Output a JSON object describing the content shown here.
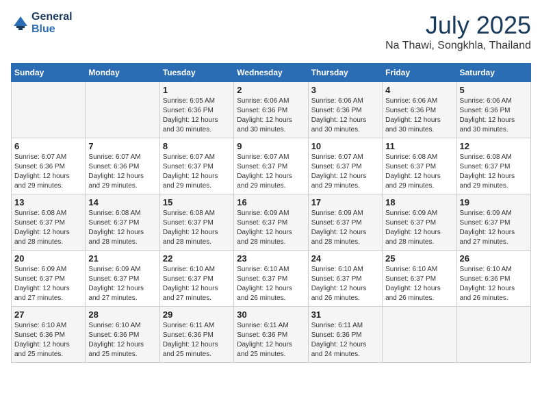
{
  "header": {
    "logo_line1": "General",
    "logo_line2": "Blue",
    "month_year": "July 2025",
    "location": "Na Thawi, Songkhla, Thailand"
  },
  "weekdays": [
    "Sunday",
    "Monday",
    "Tuesday",
    "Wednesday",
    "Thursday",
    "Friday",
    "Saturday"
  ],
  "weeks": [
    [
      {
        "day": "",
        "info": ""
      },
      {
        "day": "",
        "info": ""
      },
      {
        "day": "1",
        "info": "Sunrise: 6:05 AM\nSunset: 6:36 PM\nDaylight: 12 hours and 30 minutes."
      },
      {
        "day": "2",
        "info": "Sunrise: 6:06 AM\nSunset: 6:36 PM\nDaylight: 12 hours and 30 minutes."
      },
      {
        "day": "3",
        "info": "Sunrise: 6:06 AM\nSunset: 6:36 PM\nDaylight: 12 hours and 30 minutes."
      },
      {
        "day": "4",
        "info": "Sunrise: 6:06 AM\nSunset: 6:36 PM\nDaylight: 12 hours and 30 minutes."
      },
      {
        "day": "5",
        "info": "Sunrise: 6:06 AM\nSunset: 6:36 PM\nDaylight: 12 hours and 30 minutes."
      }
    ],
    [
      {
        "day": "6",
        "info": "Sunrise: 6:07 AM\nSunset: 6:36 PM\nDaylight: 12 hours and 29 minutes."
      },
      {
        "day": "7",
        "info": "Sunrise: 6:07 AM\nSunset: 6:36 PM\nDaylight: 12 hours and 29 minutes."
      },
      {
        "day": "8",
        "info": "Sunrise: 6:07 AM\nSunset: 6:37 PM\nDaylight: 12 hours and 29 minutes."
      },
      {
        "day": "9",
        "info": "Sunrise: 6:07 AM\nSunset: 6:37 PM\nDaylight: 12 hours and 29 minutes."
      },
      {
        "day": "10",
        "info": "Sunrise: 6:07 AM\nSunset: 6:37 PM\nDaylight: 12 hours and 29 minutes."
      },
      {
        "day": "11",
        "info": "Sunrise: 6:08 AM\nSunset: 6:37 PM\nDaylight: 12 hours and 29 minutes."
      },
      {
        "day": "12",
        "info": "Sunrise: 6:08 AM\nSunset: 6:37 PM\nDaylight: 12 hours and 29 minutes."
      }
    ],
    [
      {
        "day": "13",
        "info": "Sunrise: 6:08 AM\nSunset: 6:37 PM\nDaylight: 12 hours and 28 minutes."
      },
      {
        "day": "14",
        "info": "Sunrise: 6:08 AM\nSunset: 6:37 PM\nDaylight: 12 hours and 28 minutes."
      },
      {
        "day": "15",
        "info": "Sunrise: 6:08 AM\nSunset: 6:37 PM\nDaylight: 12 hours and 28 minutes."
      },
      {
        "day": "16",
        "info": "Sunrise: 6:09 AM\nSunset: 6:37 PM\nDaylight: 12 hours and 28 minutes."
      },
      {
        "day": "17",
        "info": "Sunrise: 6:09 AM\nSunset: 6:37 PM\nDaylight: 12 hours and 28 minutes."
      },
      {
        "day": "18",
        "info": "Sunrise: 6:09 AM\nSunset: 6:37 PM\nDaylight: 12 hours and 28 minutes."
      },
      {
        "day": "19",
        "info": "Sunrise: 6:09 AM\nSunset: 6:37 PM\nDaylight: 12 hours and 27 minutes."
      }
    ],
    [
      {
        "day": "20",
        "info": "Sunrise: 6:09 AM\nSunset: 6:37 PM\nDaylight: 12 hours and 27 minutes."
      },
      {
        "day": "21",
        "info": "Sunrise: 6:09 AM\nSunset: 6:37 PM\nDaylight: 12 hours and 27 minutes."
      },
      {
        "day": "22",
        "info": "Sunrise: 6:10 AM\nSunset: 6:37 PM\nDaylight: 12 hours and 27 minutes."
      },
      {
        "day": "23",
        "info": "Sunrise: 6:10 AM\nSunset: 6:37 PM\nDaylight: 12 hours and 26 minutes."
      },
      {
        "day": "24",
        "info": "Sunrise: 6:10 AM\nSunset: 6:37 PM\nDaylight: 12 hours and 26 minutes."
      },
      {
        "day": "25",
        "info": "Sunrise: 6:10 AM\nSunset: 6:37 PM\nDaylight: 12 hours and 26 minutes."
      },
      {
        "day": "26",
        "info": "Sunrise: 6:10 AM\nSunset: 6:36 PM\nDaylight: 12 hours and 26 minutes."
      }
    ],
    [
      {
        "day": "27",
        "info": "Sunrise: 6:10 AM\nSunset: 6:36 PM\nDaylight: 12 hours and 25 minutes."
      },
      {
        "day": "28",
        "info": "Sunrise: 6:10 AM\nSunset: 6:36 PM\nDaylight: 12 hours and 25 minutes."
      },
      {
        "day": "29",
        "info": "Sunrise: 6:11 AM\nSunset: 6:36 PM\nDaylight: 12 hours and 25 minutes."
      },
      {
        "day": "30",
        "info": "Sunrise: 6:11 AM\nSunset: 6:36 PM\nDaylight: 12 hours and 25 minutes."
      },
      {
        "day": "31",
        "info": "Sunrise: 6:11 AM\nSunset: 6:36 PM\nDaylight: 12 hours and 24 minutes."
      },
      {
        "day": "",
        "info": ""
      },
      {
        "day": "",
        "info": ""
      }
    ]
  ],
  "shaded_rows": [
    0,
    2,
    4
  ]
}
